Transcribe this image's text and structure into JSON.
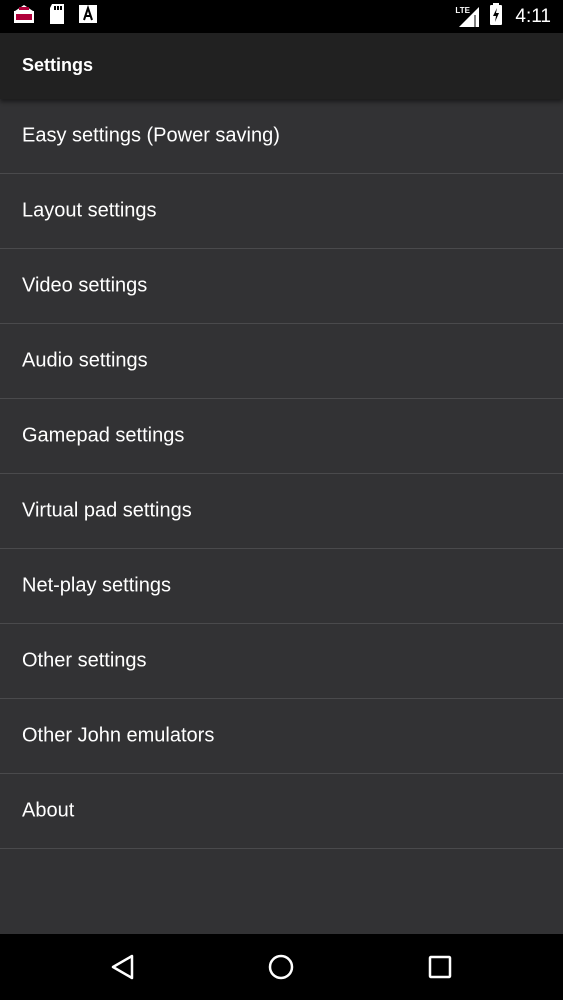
{
  "status_bar": {
    "time": "4:11",
    "network": "LTE",
    "icons": [
      "game-notification-icon",
      "sd-card-icon",
      "font-app-icon",
      "lte-signal-icon",
      "battery-charging-icon"
    ]
  },
  "toolbar": {
    "title": "Settings"
  },
  "settings": {
    "items": [
      {
        "label": "Easy settings (Power saving)"
      },
      {
        "label": "Layout settings"
      },
      {
        "label": "Video settings"
      },
      {
        "label": "Audio settings"
      },
      {
        "label": "Gamepad settings"
      },
      {
        "label": "Virtual pad settings"
      },
      {
        "label": "Net-play settings"
      },
      {
        "label": "Other settings"
      },
      {
        "label": "Other John emulators"
      },
      {
        "label": "About"
      }
    ]
  },
  "nav_bar": {
    "icons": [
      "back-icon",
      "home-icon",
      "recents-icon"
    ]
  },
  "colors": {
    "background": "#323234",
    "toolbar": "#212121",
    "status_bar": "#000000",
    "divider": "#4a4a4c",
    "text": "#ffffff"
  }
}
